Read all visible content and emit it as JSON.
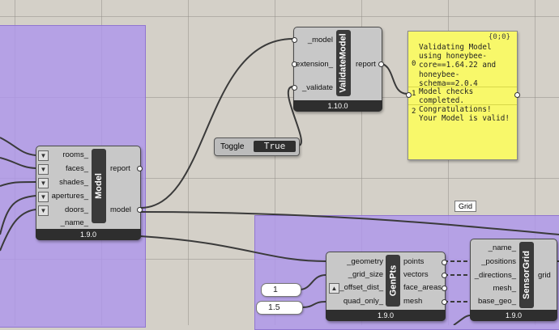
{
  "model_component": {
    "title": "Model",
    "version": "1.9.0",
    "inputs": [
      "rooms_",
      "faces_",
      "shades_",
      "apertures_",
      "doors_",
      "_name_"
    ],
    "outputs": [
      "report",
      "model"
    ]
  },
  "validate_component": {
    "title": "ValidateModel",
    "version": "1.10.0",
    "inputs": [
      "_model",
      "extension_",
      "_validate"
    ],
    "outputs": [
      "report"
    ]
  },
  "panel": {
    "header": "{0;0}",
    "rows": [
      {
        "index": "0",
        "text": "Validating Model\nusing honeybee-\ncore==1.64.22 and\nhoneybee-\nschema==2.0.4"
      },
      {
        "index": "1",
        "text": "Model checks\ncompleted."
      },
      {
        "index": "2",
        "text": "Congratulations!\nYour Model is valid!"
      }
    ]
  },
  "toggle": {
    "label": "Toggle",
    "value": "True"
  },
  "group_tag": "Grid",
  "genpts_component": {
    "title": "GenPts",
    "version": "1.9.0",
    "inputs": [
      "_geometry",
      "_grid_size",
      "_offset_dist_",
      "quad_only_"
    ],
    "outputs": [
      "points",
      "vectors",
      "face_areas",
      "mesh"
    ]
  },
  "sensorgrid_component": {
    "title": "SensorGrid",
    "version": "1.9.0",
    "inputs": [
      "_name_",
      "_positions",
      "_directions_",
      "mesh_",
      "base_geo_"
    ],
    "outputs": [
      "grid"
    ]
  },
  "sliders": [
    {
      "value": "1"
    },
    {
      "value": "1.5"
    }
  ],
  "icons": {
    "input_arrow": "down-arrow-icon",
    "offset_arrow": "up-arrow-icon"
  },
  "colors": {
    "group": "#af96eb",
    "panel": "#f8f86a",
    "canvas": "#d4d0c8",
    "component": "#c8c8c8"
  }
}
